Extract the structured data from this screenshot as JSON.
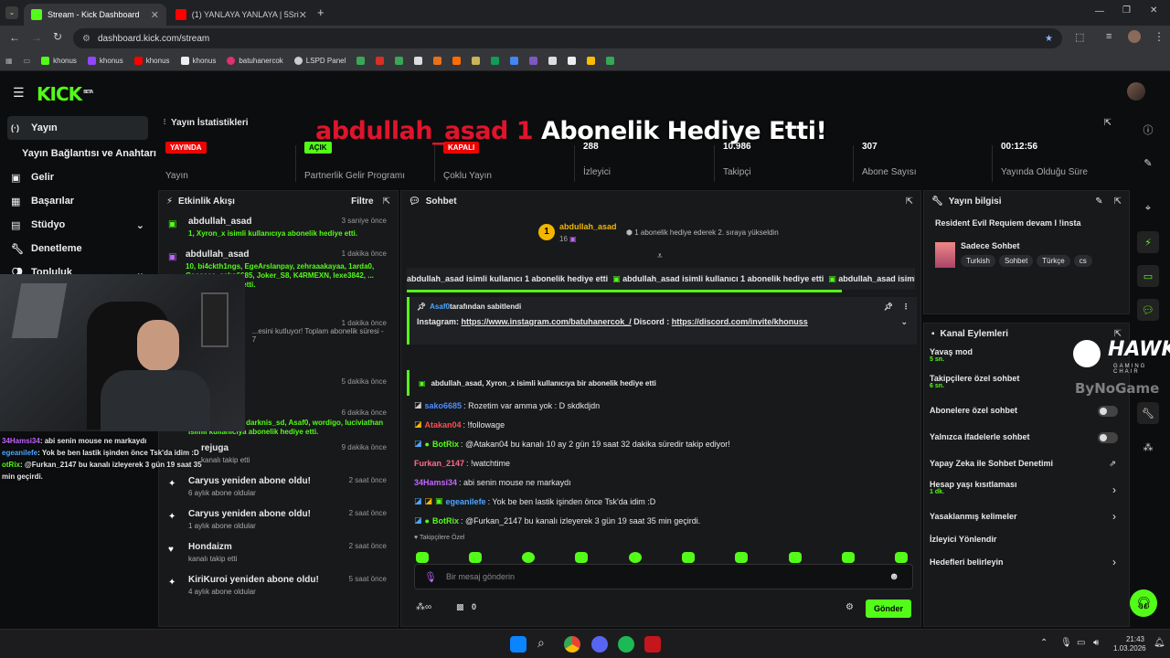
{
  "browser": {
    "tabs": [
      {
        "title": "Stream - Kick Dashboard",
        "color": "#53fc18"
      },
      {
        "title": "(1) YANLAYA YANLAYA | 5Srider",
        "color": "#ff0000"
      }
    ],
    "url": "dashboard.kick.com/stream",
    "bookmarks": [
      {
        "label": "khonus",
        "color": "#53fc18"
      },
      {
        "label": "khonus",
        "color": "#9146ff"
      },
      {
        "label": "khonus",
        "color": "#ff0000"
      },
      {
        "label": "khonus",
        "color": "#ffffff"
      },
      {
        "label": "batuhanercok",
        "color": "#e1306c"
      },
      {
        "label": "LSPD Panel",
        "color": "#cccccc"
      }
    ]
  },
  "kick": {
    "logo": "KICK",
    "beta": "BETA"
  },
  "sidebar": {
    "items": [
      {
        "label": "Yayın",
        "icon": "broadcast-icon"
      },
      {
        "label": "Yayın Bağlantısı ve Anahtarı"
      },
      {
        "label": "Gelir",
        "icon": "revenue-icon"
      },
      {
        "label": "Başarılar",
        "icon": "trophy-icon"
      },
      {
        "label": "Stüdyo",
        "icon": "studio-icon"
      },
      {
        "label": "Denetleme",
        "icon": "wrench-icon"
      },
      {
        "label": "Topluluk",
        "icon": "community-icon"
      }
    ]
  },
  "alert": {
    "name": "abdullah_asad 1",
    "text": " Abonelik Hediye Etti!"
  },
  "stats": {
    "title": "Yayın İstatistikleri",
    "cells": [
      {
        "badge": "YAYINDA",
        "badge_color": "#eb0400",
        "label": "Yayın"
      },
      {
        "badge": "AÇIK",
        "badge_color": "#53fc18",
        "label": "Partnerlik Gelir Programı"
      },
      {
        "badge": "KAPALI",
        "badge_color": "#eb0400",
        "label": "Çoklu Yayın"
      },
      {
        "value": "288",
        "label": "İzleyici"
      },
      {
        "value": "10.986",
        "label": "Takipçi"
      },
      {
        "value": "307",
        "label": "Abone Sayısı"
      },
      {
        "value": "00:12:56",
        "label": "Yayında Olduğu Süre"
      }
    ]
  },
  "activity": {
    "title": "Etkinlik Akışı",
    "filter": "Filtre",
    "items": [
      {
        "name": "abdullah_asad",
        "time": "3 saniye önce",
        "sub": "1, Xyron_x isimli kullanıcıya abonelik hediye etti."
      },
      {
        "name": "abdullah_asad",
        "time": "1 dakika önce",
        "sub": "10, bi4ckth1ngs, EgeArslanpay, zehraaakayaa, 1arda0, Cossacc, sako6685, Joker_S8, K4RMEXN, lexe3842, ... abonelik hediye etti."
      },
      {
        "name": "",
        "time": "1 dakika önce",
        "sub": "...esini kutluyor! Toplam abonelik süresi - 7"
      },
      {
        "name": "",
        "time": "5 dakika önce",
        "sub": ""
      },
      {
        "name": "",
        "time": "6 dakika önce",
        "sub": "5, Chef7neco48, darknis_sd, Asaf0, wordigo, luciviathan isimli kullanıcıya abonelik hediye etti."
      },
      {
        "name": "rejuga",
        "time": "9 dakika önce",
        "sub": "kanalı takip etti"
      },
      {
        "name": "Caryus yeniden abone oldu!",
        "time": "2 saat önce",
        "sub": "6 aylık abone oldular"
      },
      {
        "name": "Caryus yeniden abone oldu!",
        "time": "2 saat önce",
        "sub": "1 aylık abone oldular"
      },
      {
        "name": "Hondaizm",
        "time": "2 saat önce",
        "sub": "kanalı takip etti"
      },
      {
        "name": "KiriKuroi yeniden abone oldu!",
        "time": "5 saat önce",
        "sub": "4 aylık abone oldular"
      }
    ]
  },
  "chat": {
    "title": "Sohbet",
    "top_gifter": "abdullah_asad",
    "top_count": "16",
    "rank_text": "1 abonelik hediye ederek 2. sıraya yükseldin",
    "ticker": "abdullah_asad isimli kullanıcı 1 abonelik hediye etti",
    "pinned_by": "Asaf0",
    "pinned_suffix": " tarafından sabitlendi",
    "pinned_prefix": "Instagram: ",
    "pinned_link1": "https://www.instagram.com/batuhanercok_/",
    "pinned_mid": " Discord : ",
    "pinned_link2": "https://discord.com/invite/khonuss",
    "gift_line": "abdullah_asad, Xyron_x isimli kullanıcıya bir abonelik hediye etti",
    "messages": [
      {
        "user": "sako6685",
        "color": "#4d8cff",
        "text": ": Rozetim var amma yok : D skdkdjdn"
      },
      {
        "user": "Atakan04",
        "color": "#ff4d4d",
        "text": ": !followage"
      },
      {
        "user": "BotRix",
        "color": "#53fc18",
        "text": ": @Atakan04 bu kanalı 10 ay 2 gün 19 saat 32 dakika süredir takip ediyor!"
      },
      {
        "user": "Furkan_2147",
        "color": "#ff6a88",
        "text": ": !watchtime"
      },
      {
        "user": "34Hamsi34",
        "color": "#c166ff",
        "text": ": abi senin mouse ne markaydı"
      },
      {
        "user": "egeanilefe",
        "color": "#4da6ff",
        "text": ": Yok be ben lastik işinden önce Tsk'da idim :D"
      },
      {
        "user": "BotRix",
        "color": "#53fc18",
        "text": ": @Furkan_2147 bu kanalı izleyerek 3 gün 19 saat 35 min geçirdi."
      }
    ],
    "followers_only": "Takipçilere Özel",
    "placeholder": "Bir mesaj gönderin",
    "send": "Gönder",
    "count": "0"
  },
  "streaminfo": {
    "title": "Yayın bilgisi",
    "stream_title": "Resident Evil Requiem devam l !insta",
    "category": "Sadece Sohbet",
    "tags": [
      "Turkish",
      "Sohbet",
      "Türkçe",
      "cs"
    ]
  },
  "channel_actions": {
    "title": "Kanal Eylemleri",
    "items": [
      {
        "label": "Yavaş mod",
        "sub": "5 sn."
      },
      {
        "label": "Takipçilere özel sohbet",
        "sub": "6 sn."
      },
      {
        "label": "Abonelere özel sohbet",
        "sub": ""
      },
      {
        "label": "Yalnızca ifadelerle sohbet",
        "sub": ""
      },
      {
        "label": "Yapay Zeka ile Sohbet Denetimi",
        "sub": ""
      },
      {
        "label": "Hesap yaşı kısıtlaması",
        "sub": "1 dk."
      },
      {
        "label": "Yasaklanmış kelimeler",
        "sub": ""
      },
      {
        "label": "İzleyici Yönlendir",
        "sub": ""
      },
      {
        "label": "Hedefleri belirleyin",
        "sub": ""
      }
    ]
  },
  "overlay": {
    "brand": "HAWK",
    "brand_sub": "GAMING CHAIR",
    "byno": "ByNoGame",
    "cam_chat": [
      {
        "user": "34Hamsi34",
        "text": ": abi senin mouse ne markaydı"
      },
      {
        "user": "egeanilefe",
        "text": ": Yok be ben lastik işinden önce Tsk'da idim :D"
      },
      {
        "user": "otRix",
        "text": ": @Furkan_2147 bu kanalı izleyerek 3 gün 19 saat 35 min geçirdi."
      }
    ]
  },
  "taskbar": {
    "time": "21:43",
    "date": "1.03.2026"
  }
}
